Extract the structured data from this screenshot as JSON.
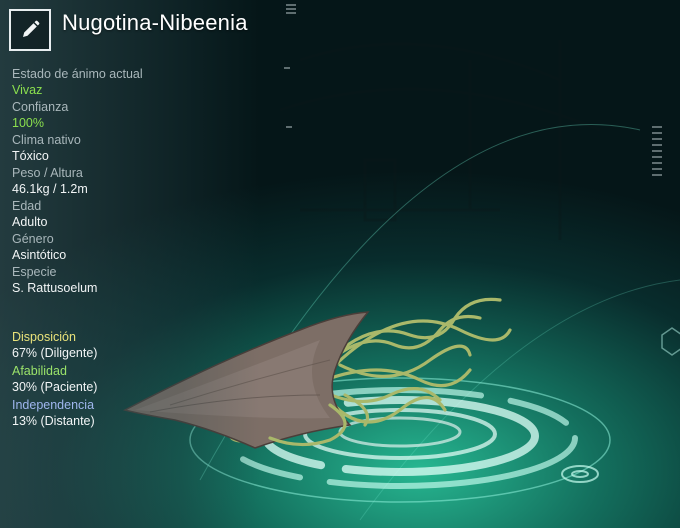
{
  "creature": {
    "name": "Nugotina-Nibeenia",
    "stats": [
      {
        "label": "Estado de ánimo actual",
        "value": "Vivaz",
        "highlight": true
      },
      {
        "label": "Confianza",
        "value": "100%",
        "highlight": true
      },
      {
        "label": "Clima nativo",
        "value": "Tóxico"
      },
      {
        "label": "Peso / Altura",
        "value": "46.1kg / 1.2m"
      },
      {
        "label": "Edad",
        "value": "Adulto"
      },
      {
        "label": "Género",
        "value": "Asintótico"
      },
      {
        "label": "Especie",
        "value": "S. Rattusoelum"
      }
    ],
    "traits": [
      {
        "label": "Disposición",
        "value": "67% (Diligente)",
        "color": "#e9e27a"
      },
      {
        "label": "Afabilidad",
        "value": "30% (Paciente)",
        "color": "#9be36a"
      },
      {
        "label": "Independencia",
        "value": "13% (Distante)",
        "color": "#9fb6ee"
      }
    ]
  },
  "edit_icon": "pencil-icon",
  "colors": {
    "accent_green": "#8be04e",
    "background_teal": "#1f8f78"
  }
}
